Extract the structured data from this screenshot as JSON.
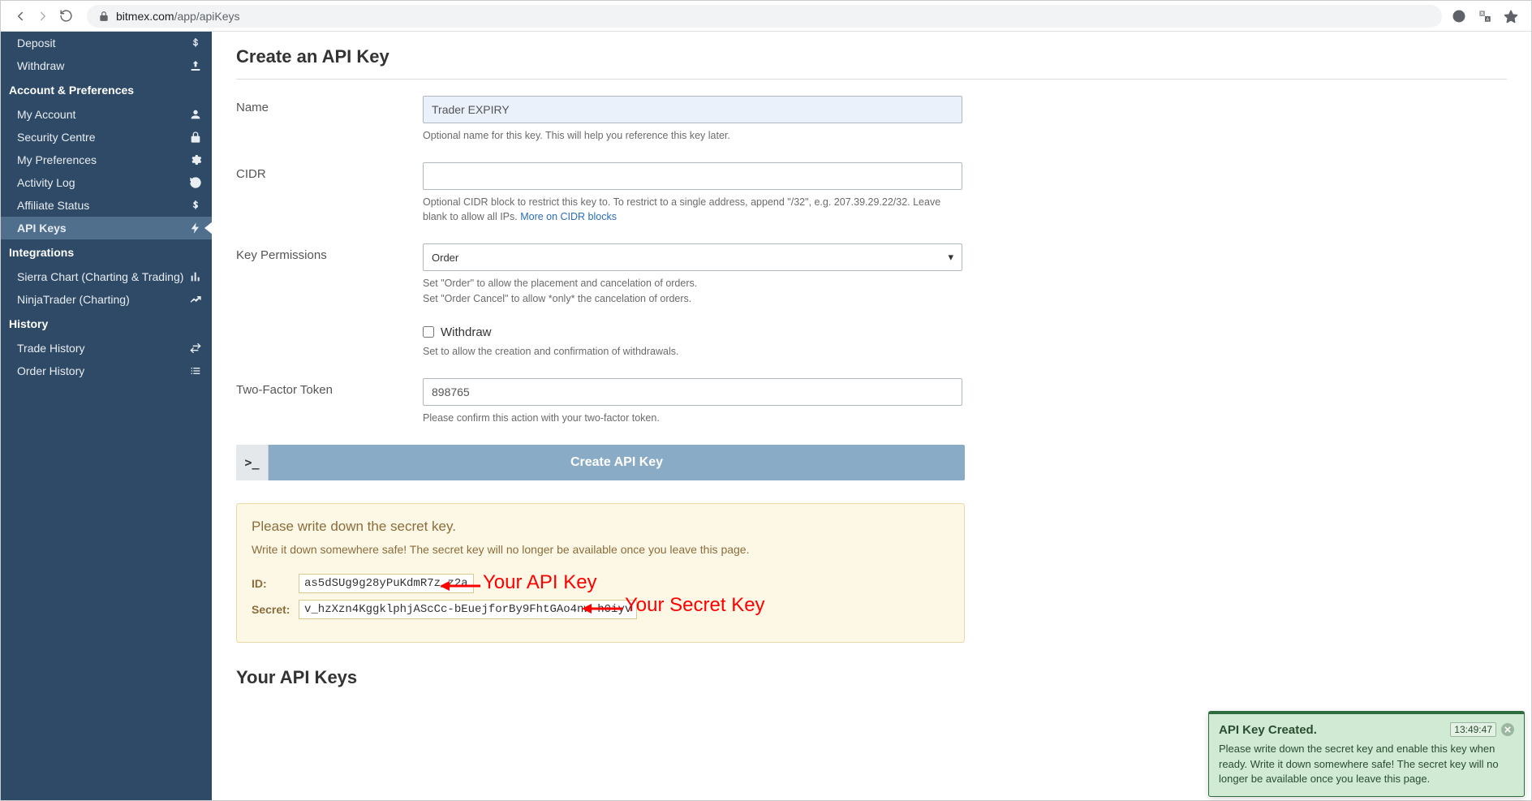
{
  "browser": {
    "url_host": "bitmex.com",
    "url_path": "/app/apiKeys"
  },
  "sidebar": {
    "items": [
      {
        "label": "Deposit",
        "icon": "btc"
      },
      {
        "label": "Withdraw",
        "icon": "upload"
      }
    ],
    "heading_account": "Account & Preferences",
    "account_items": [
      {
        "label": "My Account",
        "icon": "user"
      },
      {
        "label": "Security Centre",
        "icon": "lock"
      },
      {
        "label": "My Preferences",
        "icon": "gear"
      },
      {
        "label": "Activity Log",
        "icon": "history"
      },
      {
        "label": "Affiliate Status",
        "icon": "btc"
      },
      {
        "label": "API Keys",
        "icon": "bolt",
        "active": true
      }
    ],
    "heading_integrations": "Integrations",
    "integration_items": [
      {
        "label": "Sierra Chart (Charting & Trading)",
        "icon": "chart"
      },
      {
        "label": "NinjaTrader (Charting)",
        "icon": "trend"
      }
    ],
    "heading_history": "History",
    "history_items": [
      {
        "label": "Trade History",
        "icon": "swap"
      },
      {
        "label": "Order History",
        "icon": "list"
      }
    ]
  },
  "page": {
    "title": "Create an API Key",
    "name": {
      "label": "Name",
      "value": "Trader EXPIRY",
      "hint": "Optional name for this key. This will help you reference this key later."
    },
    "cidr": {
      "label": "CIDR",
      "value": "",
      "hint_pre": "Optional CIDR block to restrict this key to. To restrict to a single address, append \"/32\", e.g. 207.39.29.22/32. Leave blank to allow all IPs. ",
      "hint_link": "More on CIDR blocks"
    },
    "perm": {
      "label": "Key Permissions",
      "value": "Order",
      "hint1": "Set \"Order\" to allow the placement and cancelation of orders.",
      "hint2": "Set \"Order Cancel\" to allow *only* the cancelation of orders."
    },
    "withdraw": {
      "label": "Withdraw",
      "hint": "Set to allow the creation and confirmation of withdrawals."
    },
    "token": {
      "label": "Two-Factor Token",
      "value": "898765",
      "hint": "Please confirm this action with your two-factor token."
    },
    "create_button": "Create API Key",
    "cmd_prompt": ">_",
    "alert": {
      "title": "Please write down the secret key.",
      "text": "Write it down somewhere safe! The secret key will no longer be available once you leave this page.",
      "id_label": "ID:",
      "id_value": "as5dSUg9g28yPuKdmR7z_z2a",
      "secret_label": "Secret:",
      "secret_value": "v_hzXzn4KggklphjAScCc-bEuejforBy9FhtGAo4nw-h0iyv"
    },
    "annotations": {
      "api_key": "Your API Key",
      "secret_key": "Your Secret Key"
    },
    "section2": "Your API Keys"
  },
  "toast": {
    "title": "API Key Created.",
    "time": "13:49:47",
    "body": "Please write down the secret key and enable this key when ready. Write it down somewhere safe! The secret key will no longer be available once you leave this page."
  }
}
